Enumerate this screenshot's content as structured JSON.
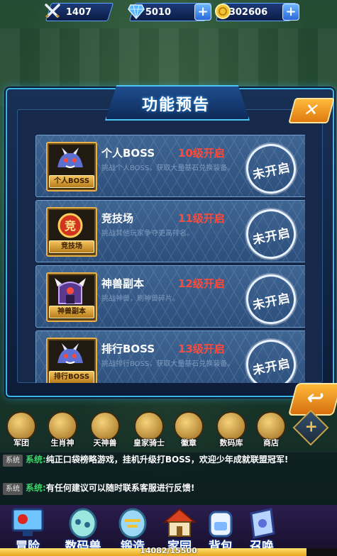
{
  "topbar": {
    "power": "1407",
    "diamonds": "5010",
    "gold": "302606"
  },
  "dialog": {
    "title": "功能预告"
  },
  "features": [
    {
      "name": "个人BOSS",
      "level": "10级开启",
      "desc": "挑战个人BOSS，获取大量基石兑换装备。",
      "thumb_label": "个人BOSS",
      "status": "未开启"
    },
    {
      "name": "竞技场",
      "level": "11级开启",
      "desc": "挑战其他玩家争夺更高排名。",
      "thumb_label": "竞技场",
      "status": "未开启"
    },
    {
      "name": "神兽副本",
      "level": "12级开启",
      "desc": "挑战神兽，刷神兽碎片。",
      "thumb_label": "神兽副本",
      "status": "未开启"
    },
    {
      "name": "排行BOSS",
      "level": "13级开启",
      "desc": "挑战排行BOSS，获取大量基石兑换装备。",
      "thumb_label": "排行BOSS",
      "status": "未开启"
    }
  ],
  "icon_strip": [
    {
      "label": "军团"
    },
    {
      "label": "生肖神"
    },
    {
      "label": "天神兽"
    },
    {
      "label": "皇家骑士"
    },
    {
      "label": "徽章"
    },
    {
      "label": "数码库"
    },
    {
      "label": "商店"
    }
  ],
  "chat": [
    {
      "tag": "系统",
      "source": "系统:",
      "text": "纯正口袋榜略游戏，挂机升级打BOSS，欢迎少年成就联盟冠军!"
    },
    {
      "tag": "系统",
      "source": "系统:",
      "text": "有任何建议可以随时联系客服进行反馈!"
    }
  ],
  "nav": [
    {
      "label": "冒险"
    },
    {
      "label": "数码兽"
    },
    {
      "label": "锻造"
    },
    {
      "label": "家园"
    },
    {
      "label": "背包"
    },
    {
      "label": "召唤"
    }
  ],
  "exp": {
    "text": "14082/15500",
    "fraction": 0.9085
  },
  "colors": {
    "level_text": "#ff4a3a",
    "chat_source": "#3fd36a",
    "dialog_border": "#39b6e8"
  }
}
